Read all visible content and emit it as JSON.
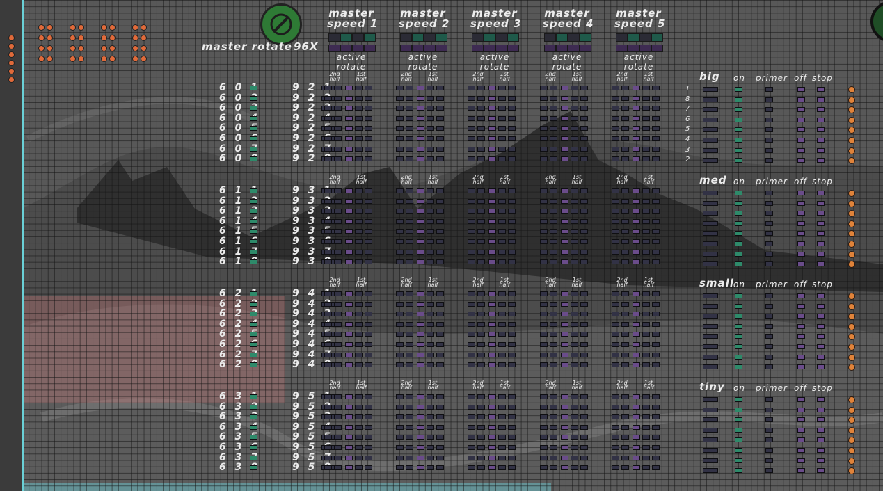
{
  "master_rotate": {
    "label": "master rotate",
    "multiplier": "96X"
  },
  "speeds": [
    {
      "line1": "master",
      "line2": "speed 1"
    },
    {
      "line1": "master",
      "line2": "speed 2"
    },
    {
      "line1": "master",
      "line2": "speed 3"
    },
    {
      "line1": "master",
      "line2": "speed 4"
    },
    {
      "line1": "master",
      "line2": "speed 5"
    }
  ],
  "active_rotate": {
    "line1": "active",
    "line2": "rotate"
  },
  "halves": {
    "second": {
      "line1": "2nd",
      "line2": "half"
    },
    "first": {
      "line1": "1st",
      "line2": "half"
    }
  },
  "rows": {
    "g1a": [
      "6 0 1",
      "6 0 2",
      "6 0 3",
      "6 0 4",
      "6 0 5",
      "6 0 6",
      "6 0 7",
      "6 0 8"
    ],
    "g1b": [
      "9 2 1",
      "9 2 2",
      "9 2 3",
      "9 2 4",
      "9 2 5",
      "9 2 6",
      "9 2 7",
      "9 2 8"
    ],
    "g2a": [
      "6 1 1",
      "6 1 2",
      "6 1 3",
      "6 1 4",
      "6 1 5",
      "6 1 6",
      "6 1 7",
      "6 1 8"
    ],
    "g2b": [
      "9 3 1",
      "9 3 2",
      "9 3 3",
      "9 3 4",
      "9 3 5",
      "9 3 6",
      "9 3 7",
      "9 3 8"
    ],
    "g3a": [
      "6 2 1",
      "6 2 2",
      "6 2 3",
      "6 2 4",
      "6 2 5",
      "6 2 6",
      "6 2 7",
      "6 2 8"
    ],
    "g3b": [
      "9 4 1",
      "9 4 2",
      "9 4 3",
      "9 4 4",
      "9 4 5",
      "9 4 6",
      "9 4 7",
      "9 4 8"
    ],
    "g4a": [
      "6 3 1",
      "6 3 2",
      "6 3 3",
      "6 3 4",
      "6 3 5",
      "6 3 6",
      "6 3 7",
      "6 3 8"
    ],
    "g4b": [
      "9 5 1",
      "9 5 2",
      "9 5 3",
      "9 5 4",
      "9 5 5",
      "9 5 6",
      "9 5 7",
      "9 5 8"
    ]
  },
  "size_panels": [
    {
      "title": "big",
      "on": "on",
      "primer": "primer",
      "off": "off",
      "stop": "stop",
      "numbers": [
        "1",
        "8",
        "7",
        "6",
        "5",
        "4",
        "3",
        "2"
      ]
    },
    {
      "title": "med",
      "on": "on",
      "primer": "primer",
      "off": "off",
      "stop": "stop"
    },
    {
      "title": "small",
      "on": "on",
      "primer": "primer",
      "off": "off",
      "stop": "stop"
    },
    {
      "title": "tiny",
      "on": "on",
      "primer": "primer",
      "off": "off",
      "stop": "stop"
    }
  ],
  "colors": {
    "accent_green": "#2e7a35",
    "dot_orange": "#e06a3a",
    "grid_line": "#141414",
    "sidebar_border": "#6ad0d6"
  }
}
